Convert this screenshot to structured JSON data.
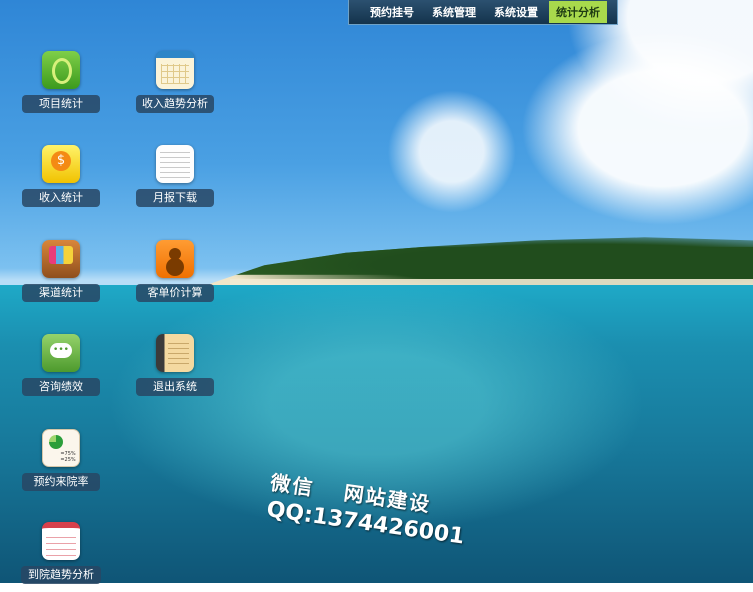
{
  "menu": {
    "items": [
      {
        "label": "预约挂号",
        "active": false
      },
      {
        "label": "系统管理",
        "active": false
      },
      {
        "label": "系统设置",
        "active": false
      },
      {
        "label": "统计分析",
        "active": true
      }
    ],
    "active_color": "#a8d94c"
  },
  "desktop_icons": [
    {
      "label": "项目统计",
      "icon": "green-ring-icon"
    },
    {
      "label": "收入趋势分析",
      "icon": "calendar-icon"
    },
    {
      "label": "收入统计",
      "icon": "coins-icon"
    },
    {
      "label": "月报下载",
      "icon": "notepad-icon"
    },
    {
      "label": "渠道统计",
      "icon": "shopping-bag-icon"
    },
    {
      "label": "客单价计算",
      "icon": "contact-icon"
    },
    {
      "label": "咨询绩效",
      "icon": "chat-icon"
    },
    {
      "label": "退出系统",
      "icon": "book-icon"
    },
    {
      "label": "预约来院率",
      "icon": "pie-chart-icon"
    },
    {
      "label": "到院趋势分析",
      "icon": "red-calendar-icon"
    }
  ],
  "watermark": {
    "wechat": "微信",
    "service": "网站建设",
    "qq": "QQ:1374426001"
  }
}
